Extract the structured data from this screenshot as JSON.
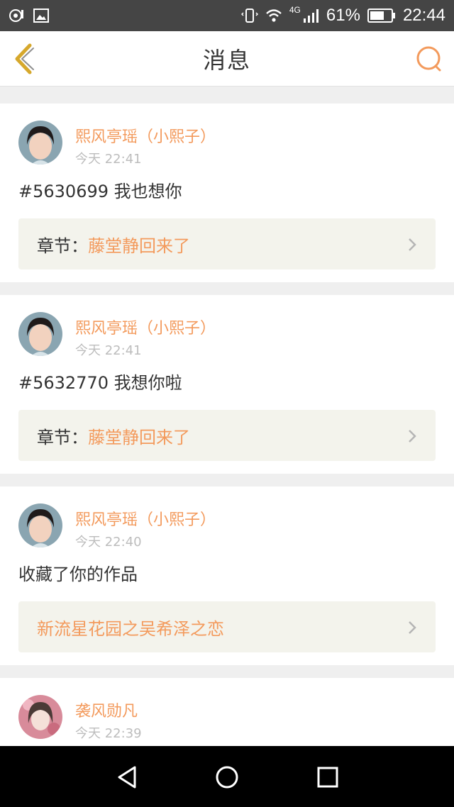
{
  "status_bar": {
    "network": "4G",
    "battery": "61%",
    "time": "22:44",
    "icons": [
      "hotspot-icon",
      "gallery-icon",
      "vibrate-icon",
      "wifi-icon",
      "signal-icon",
      "battery-icon"
    ]
  },
  "header": {
    "title": "消息",
    "back_icon": "back-chevron-icon",
    "search_icon": "search-icon"
  },
  "messages": [
    {
      "user": "熙风亭瑶（小熙子）",
      "time": "今天 22:41",
      "text": "#5630699 我也想你",
      "chapter_label": "章节：",
      "chapter_title": "藤堂静回来了"
    },
    {
      "user": "熙风亭瑶（小熙子）",
      "time": "今天 22:41",
      "text": "#5632770 我想你啦",
      "chapter_label": "章节：",
      "chapter_title": "藤堂静回来了"
    },
    {
      "user": "熙风亭瑶（小熙子）",
      "time": "今天 22:40",
      "text": "收藏了你的作品",
      "work_title": "新流星花园之吴希泽之恋"
    },
    {
      "user": "袭风勋凡",
      "time": "今天 22:39"
    }
  ],
  "colors": {
    "accent": "#f39a5c",
    "status_bar": "#454545",
    "nav_bar": "#000000",
    "link_box": "#f3f3ec",
    "back_icon": "#d6a82c"
  }
}
